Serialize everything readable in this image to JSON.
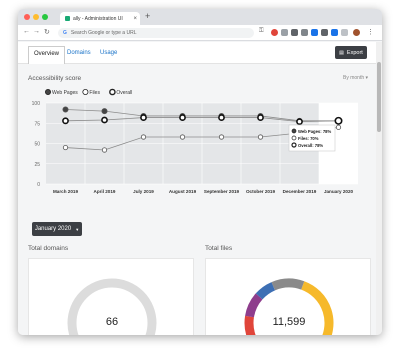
{
  "browser": {
    "tab_title": "ally - Administration UI",
    "omnibox_placeholder": "Search Google or type a URL",
    "colors": {
      "close": "#ff5f57",
      "minimize": "#febc2e",
      "maximize": "#28c840"
    }
  },
  "subnav": {
    "tabs": [
      {
        "label": "Overview",
        "active": true
      },
      {
        "label": "Domains",
        "active": false
      },
      {
        "label": "Usage",
        "active": false
      }
    ],
    "export_label": "Export"
  },
  "accessibility": {
    "title": "Accessibility score",
    "period_select": "By month"
  },
  "chart_data": {
    "type": "line",
    "categories": [
      "March 2019",
      "April 2019",
      "July 2019",
      "August 2019",
      "September 2019",
      "October 2019",
      "December 2019",
      "January 2020"
    ],
    "series": [
      {
        "name": "Web Pages",
        "values": [
          92,
          90,
          84,
          84,
          84,
          84,
          78,
          78
        ],
        "color": "#444444"
      },
      {
        "name": "Files",
        "values": [
          45,
          42,
          58,
          58,
          58,
          58,
          63,
          70
        ],
        "color": "#444444"
      },
      {
        "name": "Overall",
        "values": [
          78,
          79,
          82,
          82,
          82,
          82,
          77,
          78
        ],
        "color": "#222222"
      }
    ],
    "yticks": [
      "100",
      "75",
      "50",
      "25",
      "0"
    ],
    "ylim": [
      0,
      100
    ],
    "legend": "top-left",
    "tooltip": {
      "web_pages": "Web Pages: 78%",
      "files": "Files: 70%",
      "overall": "Overall: 78%"
    },
    "grid": true
  },
  "date_filter": {
    "label": "January 2020"
  },
  "cards": [
    {
      "title": "Total domains",
      "value": "66"
    },
    {
      "title": "Total files",
      "value": "11,599"
    }
  ],
  "donut_colors": [
    "#f6b92b",
    "#e0453a",
    "#8e3d8c",
    "#3d6fb4",
    "#8a8a8a"
  ]
}
